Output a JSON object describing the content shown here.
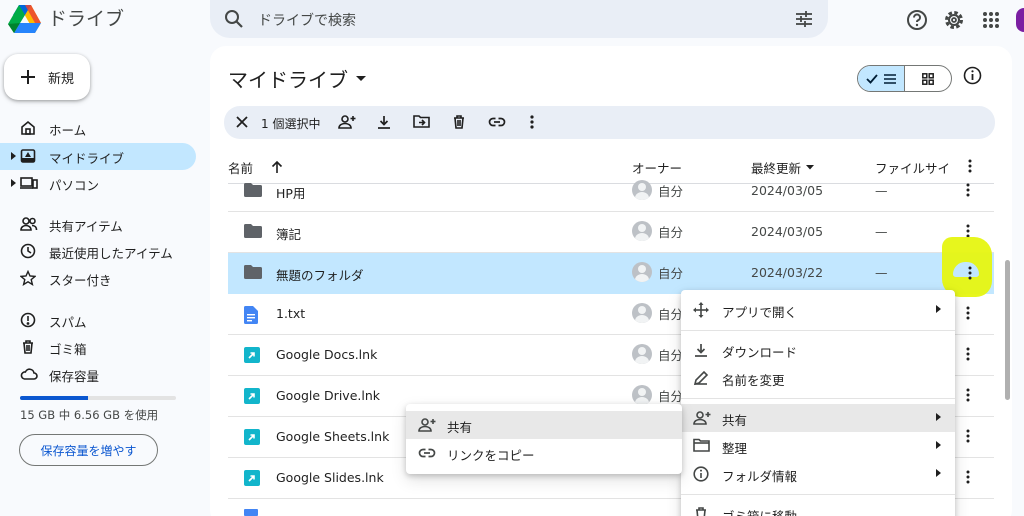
{
  "app": {
    "title": "ドライブ"
  },
  "search": {
    "placeholder": "ドライブで検索"
  },
  "sidebar": {
    "new_label": "新規",
    "items": [
      {
        "label": "ホーム",
        "icon": "home-icon"
      },
      {
        "label": "マイドライブ",
        "icon": "drive-icon",
        "active": true
      },
      {
        "label": "パソコン",
        "icon": "computer-icon"
      },
      {
        "label": "共有アイテム",
        "icon": "people-icon"
      },
      {
        "label": "最近使用したアイテム",
        "icon": "clock-icon"
      },
      {
        "label": "スター付き",
        "icon": "star-icon"
      },
      {
        "label": "スパム",
        "icon": "spam-icon"
      },
      {
        "label": "ゴミ箱",
        "icon": "trash-icon"
      },
      {
        "label": "保存容量",
        "icon": "cloud-icon"
      }
    ],
    "storage_text": "15 GB 中 6.56 GB を使用",
    "storage_fraction": 0.437,
    "more_storage_label": "保存容量を増やす"
  },
  "main": {
    "title": "マイドライブ",
    "selection_count": "1 個選択中",
    "columns": {
      "name": "名前",
      "owner": "オーナー",
      "modified": "最終更新",
      "size": "ファイルサイ"
    },
    "rows": [
      {
        "name": "HP用",
        "type": "folder",
        "owner": "自分",
        "date": "2024/03/05",
        "size": "—"
      },
      {
        "name": "簿記",
        "type": "folder",
        "owner": "自分",
        "date": "2024/03/05",
        "size": "—"
      },
      {
        "name": "無題のフォルダ",
        "type": "folder",
        "owner": "自分",
        "date": "2024/03/22",
        "size": "—",
        "selected": true
      },
      {
        "name": "1.txt",
        "type": "doc",
        "owner": "自分"
      },
      {
        "name": "Google Docs.lnk",
        "type": "lnk",
        "owner": "自分"
      },
      {
        "name": "Google Drive.lnk",
        "type": "lnk",
        "owner": "自分"
      },
      {
        "name": "Google Sheets.lnk",
        "type": "lnk",
        "owner": ""
      },
      {
        "name": "Google Slides.lnk",
        "type": "lnk",
        "owner": ""
      }
    ]
  },
  "context_menu": {
    "open_with": "アプリで開く",
    "download": "ダウンロード",
    "rename": "名前を変更",
    "share": "共有",
    "organize": "整理",
    "folder_info": "フォルダ情報",
    "move_to_trash": "ゴミ箱に移動"
  },
  "share_submenu": {
    "share": "共有",
    "copy_link": "リンクをコピー"
  },
  "colors": {
    "accent": "#0b57d0",
    "selected_row": "#c2e7ff",
    "highlight": "#e6f511"
  }
}
